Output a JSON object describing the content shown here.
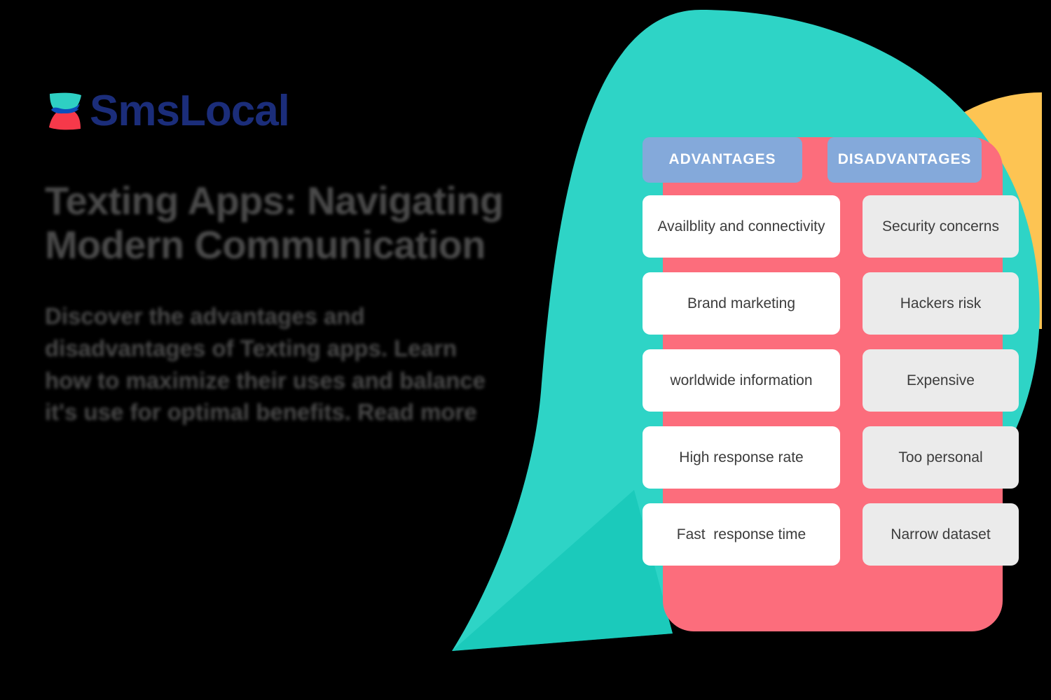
{
  "brand": {
    "name": "SmsLocal",
    "logo_icon": "leaf-mark-icon",
    "wordmark_color": "#1b2d7a",
    "leaf_teal": "#2ed0c3",
    "leaf_red": "#f6394a",
    "leaf_overlap_blue": "#0a4fbc"
  },
  "article": {
    "headline": "Texting Apps: Navigating Modern Communication",
    "summary": "Discover the advantages and disadvantages of Texting apps. Learn how to maximize their uses and balance it's use for optimal benefits. Read more"
  },
  "comparison": {
    "headers": {
      "advantages": "ADVANTAGES",
      "disadvantages": "DISADVANTAGES"
    },
    "advantages": [
      "Availblity and connectivity",
      "Brand marketing",
      "worldwide information",
      "High response rate",
      "Fast  response time"
    ],
    "disadvantages": [
      "Security concerns",
      "Hackers risk",
      "Expensive",
      "Too personal",
      "Narrow dataset"
    ]
  },
  "colors": {
    "background": "#000000",
    "teal_bubble": "#2ed4c6",
    "teal_bubble_dark": "#15c3b4",
    "coral_panel": "#fc6d7c",
    "yellow_accent": "#fdc453",
    "header_blue": "#84a9da",
    "cell_white": "#ffffff",
    "cell_grey": "#ebebeb",
    "text_grey": "#4a4a4a"
  }
}
